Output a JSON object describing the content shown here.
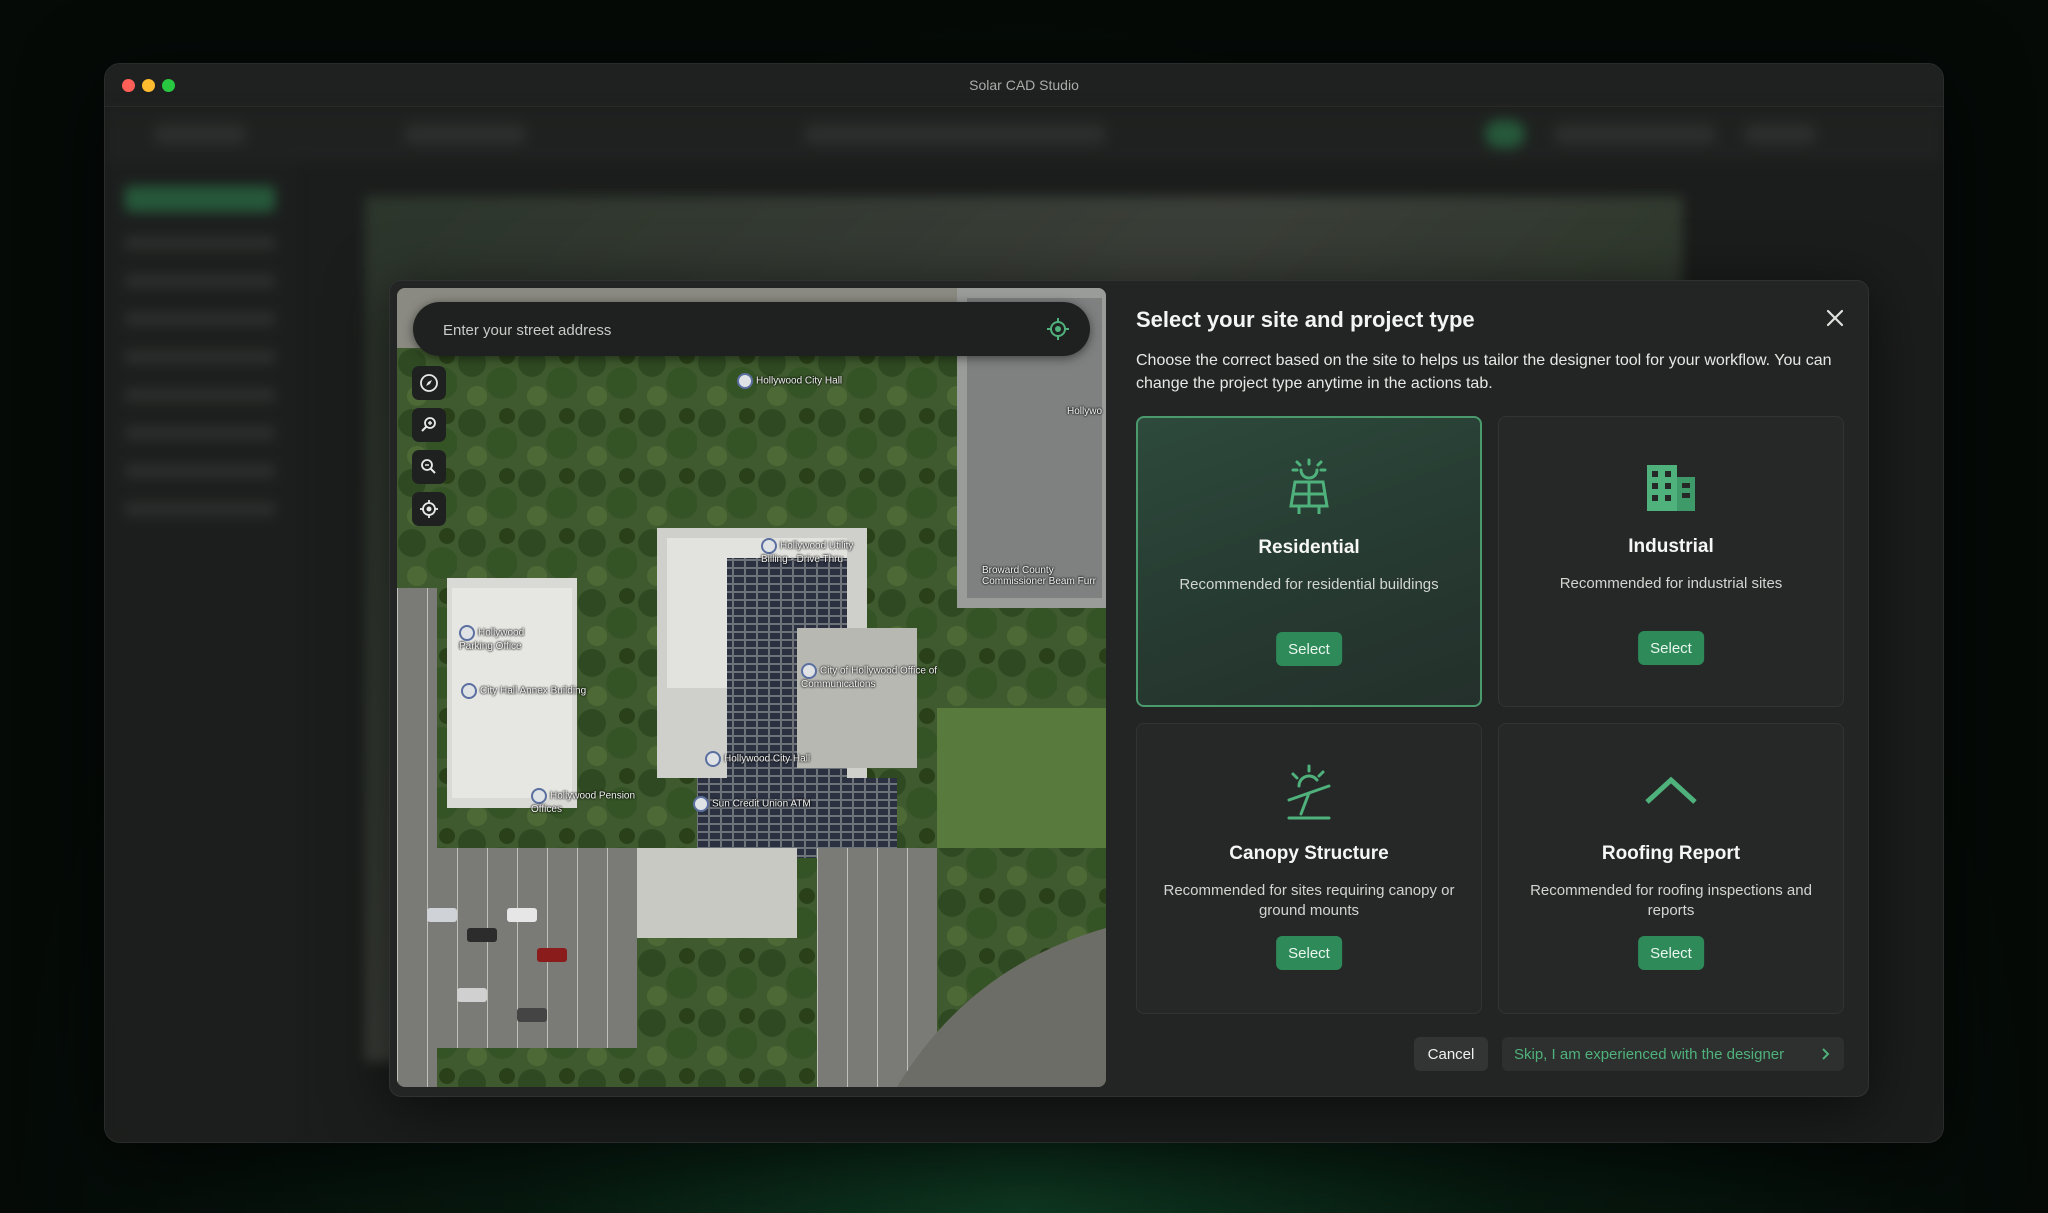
{
  "window": {
    "title": "Solar CAD Studio"
  },
  "map": {
    "search_placeholder": "Enter your street address",
    "tools": [
      "compass-icon",
      "zoom-in-icon",
      "zoom-out-icon",
      "locate-icon"
    ],
    "labels": {
      "city_hall_top": "Hollywood City Hall",
      "utility_billing": "Hollywood Utility Billing - Drive Thru",
      "broward": "Broward County Commissioner Beam Furr",
      "parking": "Hollywood Parking Office",
      "annex": "City Hall Annex Building",
      "office_comm": "City of Hollywood Office of Communications",
      "city_hall": "Hollywood City Hall",
      "credit_union": "Sun Credit Union ATM",
      "pension": "Hollywood Pension Offices",
      "edge": "Hollywo"
    }
  },
  "modal": {
    "title": "Select your site and project type",
    "description": "Choose the correct based on the site to helps us tailor the designer tool for your workflow. You can change the project type anytime in the actions tab.",
    "cards": [
      {
        "name": "Residential",
        "description": "Recommended for residential buildings",
        "button": "Select",
        "selected": true,
        "icon": "solar-house-icon"
      },
      {
        "name": "Industrial",
        "description": "Recommended for industrial sites",
        "button": "Select",
        "selected": false,
        "icon": "building-icon"
      },
      {
        "name": "Canopy Structure",
        "description": "Recommended for sites requiring canopy or ground mounts",
        "button": "Select",
        "selected": false,
        "icon": "canopy-icon"
      },
      {
        "name": "Roofing Report",
        "description": "Recommended for roofing inspections and reports",
        "button": "Select",
        "selected": false,
        "icon": "roof-icon"
      }
    ],
    "cancel_label": "Cancel",
    "skip_label": "Skip, I am experienced with the designer"
  },
  "colors": {
    "accent": "#2f8a5a",
    "accent_text": "#4fb17b",
    "panel": "#232524"
  }
}
